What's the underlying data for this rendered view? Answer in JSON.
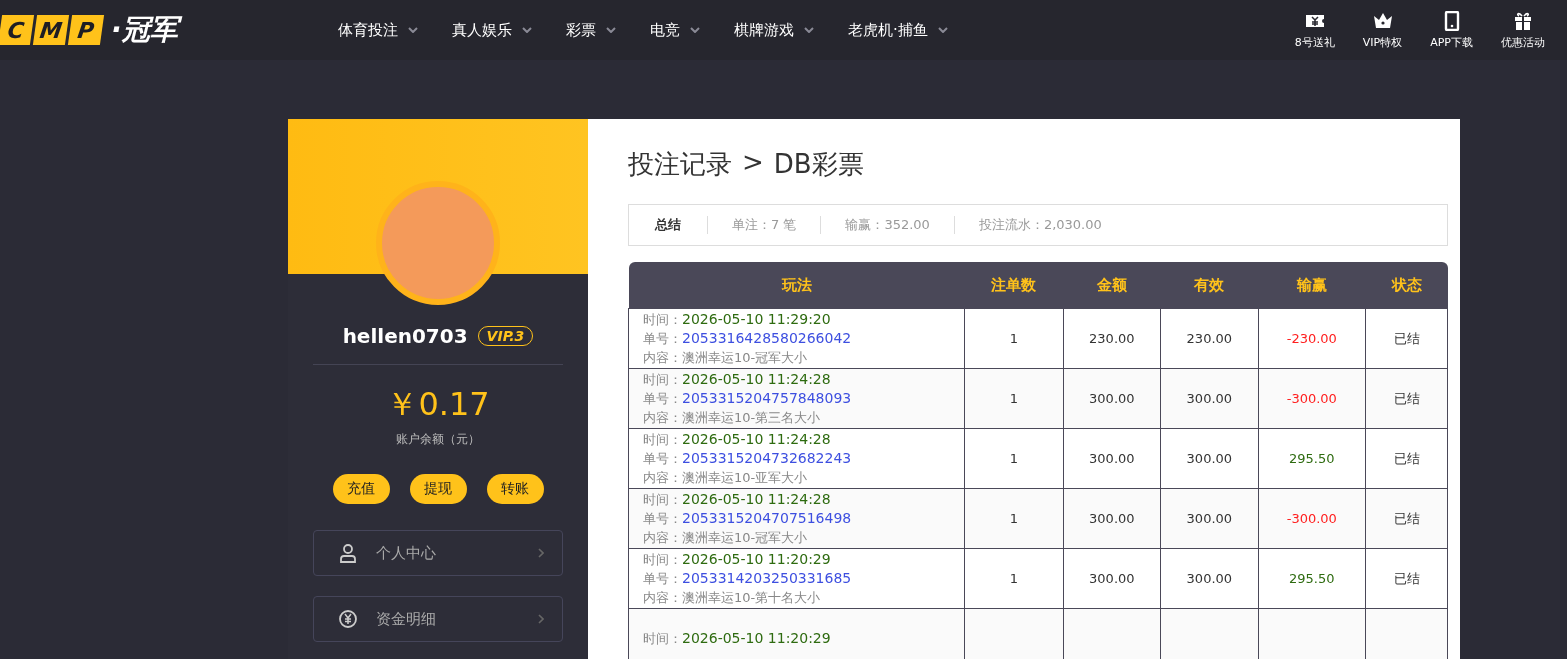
{
  "header": {
    "logo_letters": [
      "C",
      "M",
      "P"
    ],
    "logo_text": "·冠军",
    "nav": [
      {
        "label": "体育投注"
      },
      {
        "label": "真人娱乐"
      },
      {
        "label": "彩票"
      },
      {
        "label": "电竞"
      },
      {
        "label": "棋牌游戏"
      },
      {
        "label": "老虎机·捕鱼"
      }
    ],
    "quick_links": [
      {
        "kind": "ticket",
        "label": "8号送礼"
      },
      {
        "kind": "crown",
        "label": "VIP特权"
      },
      {
        "kind": "phone",
        "label": "APP下载"
      },
      {
        "kind": "gift",
        "label": "优惠活动"
      }
    ]
  },
  "sidebar": {
    "username": "hellen0703",
    "vip": "VIP.3",
    "balance": "￥0.17",
    "balance_label": "账户余额（元）",
    "actions": [
      "充值",
      "提现",
      "转账"
    ],
    "menu": [
      {
        "kind": "user",
        "label": "个人中心"
      },
      {
        "kind": "money",
        "label": "资金明细"
      }
    ]
  },
  "main": {
    "breadcrumb": [
      "投注记录",
      ">",
      "DB彩票"
    ],
    "summary": {
      "title": "总结",
      "items": [
        "单注：7 笔",
        "输赢：352.00",
        "投注流水：2,030.00"
      ]
    },
    "table": {
      "columns": [
        "玩法",
        "注单数",
        "金额",
        "有效",
        "输赢",
        "状态"
      ],
      "rows": [
        {
          "time_label": "时间：",
          "time": "2026-05-10 11:29:20",
          "id_label": "单号：",
          "id": "2053316428580266042",
          "content": "内容：澳洲幸运10-冠军大小",
          "count": "1",
          "amount": "230.00",
          "valid": "230.00",
          "profit": "-230.00",
          "color": "#ff2020",
          "status": "已结"
        },
        {
          "time_label": "时间：",
          "time": "2026-05-10 11:24:28",
          "id_label": "单号：",
          "id": "2053315204757848093",
          "content": "内容：澳洲幸运10-第三名大小",
          "count": "1",
          "amount": "300.00",
          "valid": "300.00",
          "profit": "-300.00",
          "color": "#ff2020",
          "status": "已结"
        },
        {
          "time_label": "时间：",
          "time": "2026-05-10 11:24:28",
          "id_label": "单号：",
          "id": "2053315204732682243",
          "content": "内容：澳洲幸运10-亚军大小",
          "count": "1",
          "amount": "300.00",
          "valid": "300.00",
          "profit": "295.50",
          "color": "#2e6b10",
          "status": "已结"
        },
        {
          "time_label": "时间：",
          "time": "2026-05-10 11:24:28",
          "id_label": "单号：",
          "id": "2053315204707516498",
          "content": "内容：澳洲幸运10-冠军大小",
          "count": "1",
          "amount": "300.00",
          "valid": "300.00",
          "profit": "-300.00",
          "color": "#ff2020",
          "status": "已结"
        },
        {
          "time_label": "时间：",
          "time": "2026-05-10 11:20:29",
          "id_label": "单号：",
          "id": "2053314203250331685",
          "content": "内容：澳洲幸运10-第十名大小",
          "count": "1",
          "amount": "300.00",
          "valid": "300.00",
          "profit": "295.50",
          "color": "#2e6b10",
          "status": "已结"
        },
        {
          "time_label": "时间：",
          "time": "2026-05-10 11:20:29"
        }
      ]
    }
  }
}
